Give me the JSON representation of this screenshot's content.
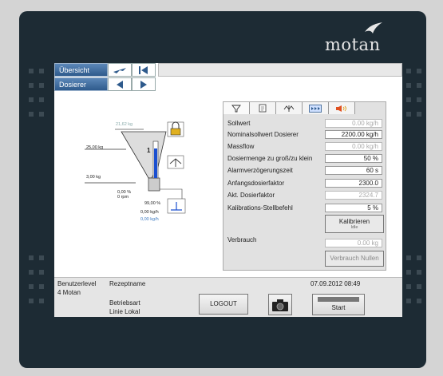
{
  "brand": {
    "name": "motan"
  },
  "nav": {
    "overview_label": "Übersicht",
    "doser_label": "Dosierer"
  },
  "diagram": {
    "target_weight": "21,62 kg",
    "max_level": "25,00 kg",
    "min_level": "3,00 kg",
    "hopper_number": "1",
    "percent": "0,00 %",
    "rpm": "0 rpm",
    "dose_percent": "99,00 %",
    "flow1": "0,00 kg/h",
    "flow2": "0,00 kg/h"
  },
  "panel": {
    "tab_icons": [
      "funnel-icon",
      "document-icon",
      "scale-icon",
      "fast-forward-icon",
      "speaker-icon"
    ],
    "rows": [
      {
        "label": "Sollwert",
        "value": "0.00 kg/h",
        "dim": true
      },
      {
        "label": "Nominalsollwert Dosierer",
        "value": "2200.00 kg/h",
        "dim": false
      },
      {
        "label": "Massflow",
        "value": "0.00 kg/h",
        "dim": true
      },
      {
        "label": "Dosiermenge zu groß/zu klein",
        "value": "50 %",
        "dim": false
      },
      {
        "label": "Alarmverzögerungszeit",
        "value": "60 s",
        "dim": false
      },
      {
        "label": "Anfangsdosierfaktor",
        "value": "2300.0",
        "dim": false
      },
      {
        "label": "Akt. Dosierfaktor",
        "value": "2324.7",
        "dim": true
      },
      {
        "label": "Kalibrations-Stellbefehl",
        "value": "5 %",
        "dim": false
      }
    ],
    "calibrate_label": "Kalibrieren",
    "calibrate_sub": "Idle",
    "consumption_label": "Verbrauch",
    "consumption_value": "0.00 kg",
    "reset_label": "Verbrauch Nullen"
  },
  "status": {
    "userlevel_label": "Benutzerlevel",
    "userlevel_value": "4  Motan",
    "recipe_label": "Rezeptname",
    "mode_label": "Betriebsart",
    "line_label": "Linie Lokal",
    "datetime": "07.09.2012 08:49",
    "logout_label": "LOGOUT",
    "start_label": "Start"
  },
  "colors": {
    "nav_blue": "#2e5a8c",
    "bezel": "#1d2b34",
    "level_blue": "#1a4fd0"
  }
}
